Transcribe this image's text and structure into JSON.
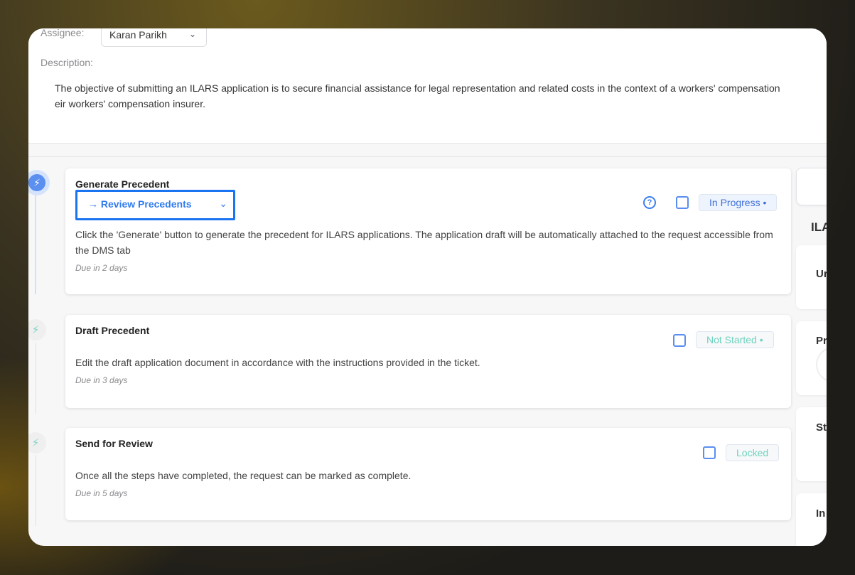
{
  "header": {
    "assignee_label": "Assignee:",
    "assignee_value": "Karan Parikh",
    "description_label": "Description:",
    "description_line1": "The objective of submitting an ILARS application is to secure financial assistance for legal representation and related costs in the context of a workers' compensation",
    "description_line2": "eir workers' compensation insurer."
  },
  "steps": [
    {
      "title": "Generate Precedent",
      "action": "Review Precedents",
      "text": "Click the 'Generate' button to generate the precedent for ILARS applications. The application draft will be automatically attached to the request accessible from the DMS tab",
      "due": "Due in 2 days",
      "status": "In Progress •",
      "status_color": "#3f6fd8",
      "status_bg": "#eef4fd"
    },
    {
      "title": "Draft Precedent",
      "text": "Edit the draft application document in accordance with the instructions provided in the ticket.",
      "due": "Due in 3 days",
      "status": "Not Started •",
      "status_color": "#6fd3be",
      "status_bg": "#f6f8fa"
    },
    {
      "title": "Send for Review",
      "text": "Once all the steps have completed, the request can be marked as complete.",
      "due": "Due in 5 days",
      "status": "Locked",
      "status_color": "#6fd3be",
      "status_bg": "#f6f8fa"
    }
  ],
  "right_panel": {
    "heading": "ILA",
    "cards": [
      "Ur",
      "Pr",
      "St",
      "In"
    ]
  },
  "colors": {
    "accent": "#1a73f0",
    "step_icon": "#5b8ff0"
  }
}
